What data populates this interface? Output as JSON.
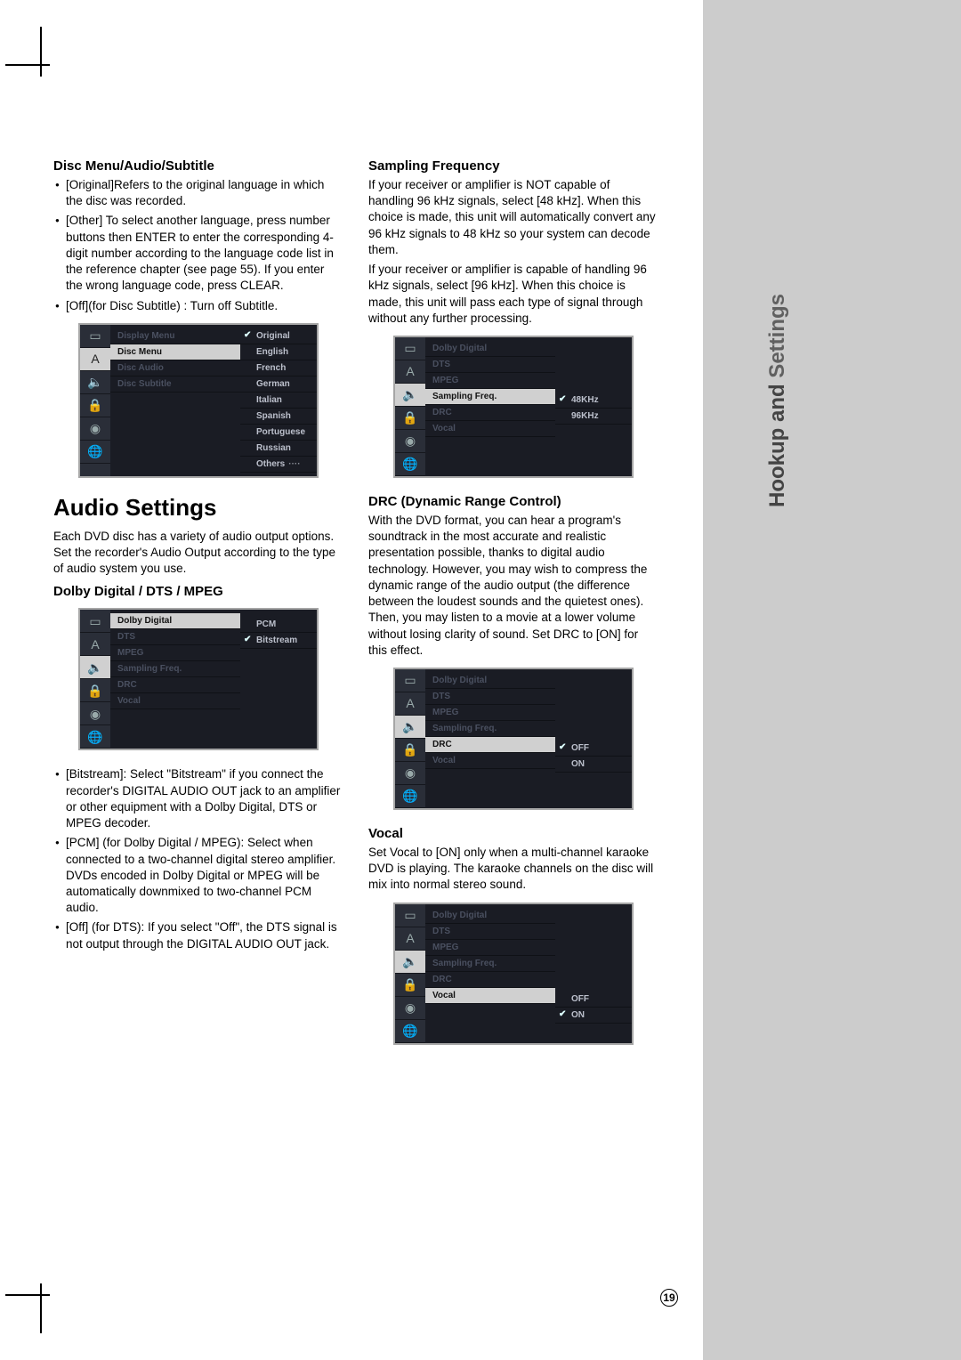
{
  "sideTab": {
    "line1": "Hookup and",
    "line2": "Settings"
  },
  "pageNumber": "19",
  "left": {
    "h3a": "Disc Menu/Audio/Subtitle",
    "bulletsA": [
      "[Original]Refers to the original language in which the disc was recorded.",
      "[Other] To select another language, press number buttons then ENTER to enter the corresponding 4-digit number according to the language code list in the reference chapter (see page 55). If you enter the wrong language code, press CLEAR.",
      "[Off](for Disc Subtitle) : Turn off Subtitle."
    ],
    "h2": "Audio Settings",
    "pAudio": "Each DVD disc has a variety of audio output options. Set the recorder's Audio Output according to the type of audio system you use.",
    "h3b": "Dolby Digital / DTS / MPEG",
    "bulletsB": [
      "[Bitstream]: Select \"Bitstream\" if you connect the recorder's DIGITAL AUDIO OUT jack to an amplifier or other equipment with a Dolby Digital, DTS or MPEG decoder.",
      "[PCM] (for Dolby Digital / MPEG): Select when connected to a two-channel digital stereo amplifier. DVDs encoded in Dolby Digital or MPEG will be automatically downmixed to two-channel PCM audio.",
      "[Off] (for DTS): If you select \"Off\", the DTS signal is not output through the DIGITAL AUDIO OUT jack."
    ]
  },
  "right": {
    "h3a": "Sampling Frequency",
    "pA1": "If your receiver or amplifier is NOT capable of handling 96 kHz signals, select [48 kHz]. When this choice is made, this unit will automatically convert any 96 kHz signals to 48 kHz so your system can decode them.",
    "pA2": "If your receiver or amplifier is capable of handling 96 kHz signals, select [96 kHz]. When this choice is made, this unit will pass each type of signal through without any further processing.",
    "h3b": "DRC (Dynamic Range Control)",
    "pB": "With the DVD format, you can hear a program's soundtrack in the most accurate and realistic presentation possible, thanks to digital audio technology. However, you may wish to compress the dynamic range of the audio output (the difference between the loudest sounds and the quietest ones). Then, you may listen to a movie at a lower volume without losing clarity of sound. Set DRC to [ON] for this effect.",
    "h3c": "Vocal",
    "pC": "Set Vocal to [ON] only when a multi-channel karaoke DVD is playing. The karaoke channels on the disc will mix into normal stereo sound."
  },
  "osd_icons": [
    "tv",
    "A",
    "spk",
    "lock",
    "disc",
    "net"
  ],
  "osd1": {
    "mid": [
      "Display Menu",
      "Disc Menu",
      "Disc Audio",
      "Disc Subtitle"
    ],
    "midActive": 1,
    "right": [
      "Original",
      "English",
      "French",
      "German",
      "Italian",
      "Spanish",
      "Portuguese",
      "Russian",
      "Others"
    ],
    "rightChecked": 0,
    "iconSel": 1
  },
  "osd2": {
    "mid": [
      "Dolby Digital",
      "DTS",
      "MPEG",
      "Sampling Freq.",
      "DRC",
      "Vocal"
    ],
    "midActive": 0,
    "right": [
      "PCM",
      "Bitstream"
    ],
    "rightChecked": 1,
    "iconSel": 2
  },
  "osd3": {
    "mid": [
      "Dolby Digital",
      "DTS",
      "MPEG",
      "Sampling Freq.",
      "DRC",
      "Vocal"
    ],
    "midActive": 3,
    "right": [
      "48KHz",
      "96KHz"
    ],
    "rightChecked": 0,
    "iconSel": 2
  },
  "osd4": {
    "mid": [
      "Dolby Digital",
      "DTS",
      "MPEG",
      "Sampling Freq.",
      "DRC",
      "Vocal"
    ],
    "midActive": 4,
    "right": [
      "OFF",
      "ON"
    ],
    "rightChecked": 0,
    "iconSel": 2
  },
  "osd5": {
    "mid": [
      "Dolby Digital",
      "DTS",
      "MPEG",
      "Sampling Freq.",
      "DRC",
      "Vocal"
    ],
    "midActive": 5,
    "right": [
      "OFF",
      "ON"
    ],
    "rightChecked": 1,
    "iconSel": 2
  }
}
